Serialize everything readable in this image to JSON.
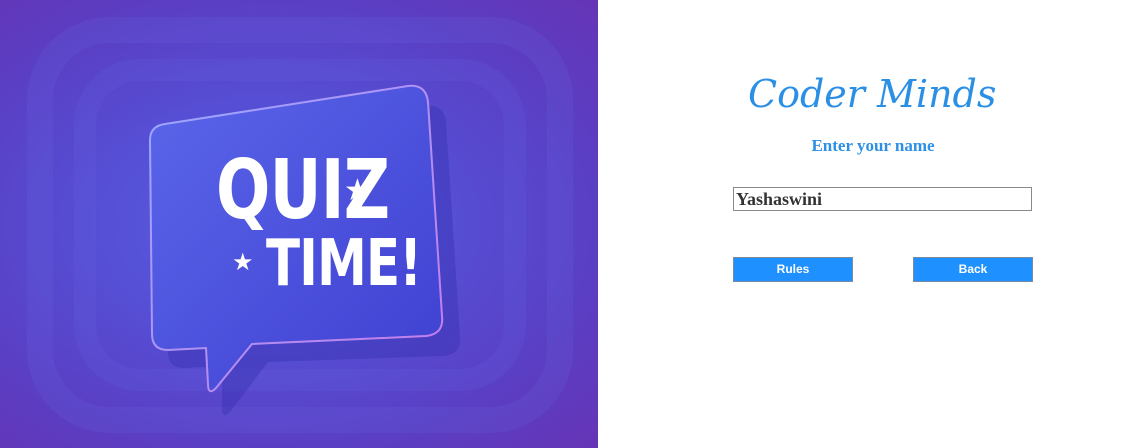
{
  "hero": {
    "line1": "QUIZ",
    "line2": "TIME!",
    "star": "★",
    "colors": {
      "background_center": "#5d5fe0",
      "background_edge": "#6634b6",
      "bubble": "#4d52dc"
    }
  },
  "form": {
    "brand": "Coder Minds",
    "prompt": "Enter your name",
    "name_value": "Yashaswini",
    "rules_label": "Rules",
    "back_label": "Back"
  },
  "colors": {
    "accent": "#1e90ff",
    "brand_text": "#2b8fe6"
  }
}
